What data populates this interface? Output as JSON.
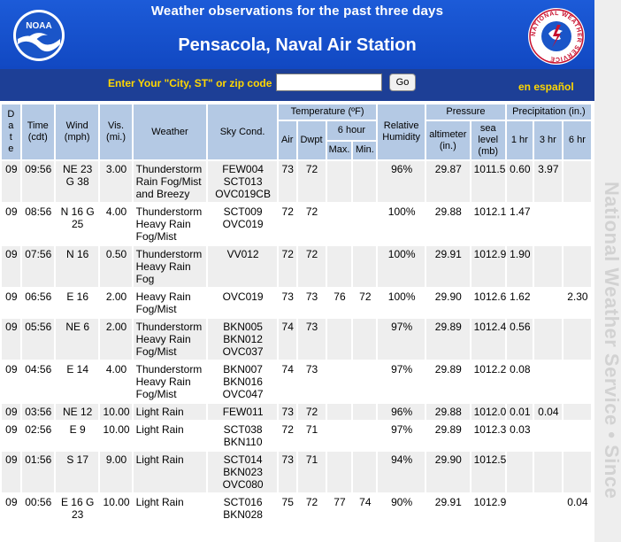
{
  "header": {
    "title": "Weather observations for the past three days",
    "station": "Pensacola, Naval Air Station",
    "noaa_logo_text": "NOAA",
    "nws_logo_text": "NATIONAL WEATHER SERVICE"
  },
  "search": {
    "prompt": "Enter Your \"City, ST\" or zip code",
    "value": "",
    "go_label": "Go",
    "espanol_label": "en español"
  },
  "side_strip": {
    "text": "National Weather Service • Since"
  },
  "colors": {
    "header_blue": "#1148c2",
    "bar_blue": "#1d3f96",
    "yellow": "#ffd700",
    "header_cell": "#b4c9e4",
    "row_alt": "#eeeeee"
  },
  "table": {
    "headers": {
      "date": "D a t e",
      "time": "Time (cdt)",
      "wind": "Wind (mph)",
      "vis": "Vis. (mi.)",
      "weather": "Weather",
      "sky": "Sky Cond.",
      "temperature": "Temperature (ºF)",
      "humidity": "Relative Humidity",
      "pressure": "Pressure",
      "precip": "Precipitation (in.)",
      "air": "Air",
      "dwpt": "Dwpt",
      "six_hour": "6 hour",
      "max": "Max.",
      "min": "Min.",
      "altimeter": "altimeter (in.)",
      "sea_level": "sea level (mb)",
      "p1": "1 hr",
      "p3": "3 hr",
      "p6": "6 hr"
    },
    "rows": [
      {
        "date": "09",
        "time": "09:56",
        "wind": "NE 23 G 38",
        "vis": "3.00",
        "weather": "Thunderstorm Rain Fog/Mist and Breezy",
        "sky": "FEW004 SCT013 OVC019CB",
        "air": "73",
        "dwpt": "72",
        "max": "",
        "min": "",
        "hum": "96%",
        "alt": "29.87",
        "sea": "1011.5",
        "p1": "0.60",
        "p3": "3.97",
        "p6": ""
      },
      {
        "date": "09",
        "time": "08:56",
        "wind": "N 16 G 25",
        "vis": "4.00",
        "weather": "Thunderstorm Heavy Rain Fog/Mist",
        "sky": "SCT009 OVC019",
        "air": "72",
        "dwpt": "72",
        "max": "",
        "min": "",
        "hum": "100%",
        "alt": "29.88",
        "sea": "1012.1",
        "p1": "1.47",
        "p3": "",
        "p6": ""
      },
      {
        "date": "09",
        "time": "07:56",
        "wind": "N 16",
        "vis": "0.50",
        "weather": "Thunderstorm Heavy Rain Fog",
        "sky": "VV012",
        "air": "72",
        "dwpt": "72",
        "max": "",
        "min": "",
        "hum": "100%",
        "alt": "29.91",
        "sea": "1012.9",
        "p1": "1.90",
        "p3": "",
        "p6": ""
      },
      {
        "date": "09",
        "time": "06:56",
        "wind": "E 16",
        "vis": "2.00",
        "weather": "Heavy Rain Fog/Mist",
        "sky": "OVC019",
        "air": "73",
        "dwpt": "73",
        "max": "76",
        "min": "72",
        "hum": "100%",
        "alt": "29.90",
        "sea": "1012.6",
        "p1": "1.62",
        "p3": "",
        "p6": "2.30"
      },
      {
        "date": "09",
        "time": "05:56",
        "wind": "NE 6",
        "vis": "2.00",
        "weather": "Thunderstorm Heavy Rain Fog/Mist",
        "sky": "BKN005 BKN012 OVC037",
        "air": "74",
        "dwpt": "73",
        "max": "",
        "min": "",
        "hum": "97%",
        "alt": "29.89",
        "sea": "1012.4",
        "p1": "0.56",
        "p3": "",
        "p6": ""
      },
      {
        "date": "09",
        "time": "04:56",
        "wind": "E 14",
        "vis": "4.00",
        "weather": "Thunderstorm Heavy Rain Fog/Mist",
        "sky": "BKN007 BKN016 OVC047",
        "air": "74",
        "dwpt": "73",
        "max": "",
        "min": "",
        "hum": "97%",
        "alt": "29.89",
        "sea": "1012.2",
        "p1": "0.08",
        "p3": "",
        "p6": ""
      },
      {
        "date": "09",
        "time": "03:56",
        "wind": "NE 12",
        "vis": "10.00",
        "weather": "Light Rain",
        "sky": "FEW011",
        "air": "73",
        "dwpt": "72",
        "max": "",
        "min": "",
        "hum": "96%",
        "alt": "29.88",
        "sea": "1012.0",
        "p1": "0.01",
        "p3": "0.04",
        "p6": ""
      },
      {
        "date": "09",
        "time": "02:56",
        "wind": "E 9",
        "vis": "10.00",
        "weather": "Light Rain",
        "sky": "SCT038 BKN110",
        "air": "72",
        "dwpt": "71",
        "max": "",
        "min": "",
        "hum": "97%",
        "alt": "29.89",
        "sea": "1012.3",
        "p1": "0.03",
        "p3": "",
        "p6": ""
      },
      {
        "date": "09",
        "time": "01:56",
        "wind": "S 17",
        "vis": "9.00",
        "weather": "Light Rain",
        "sky": "SCT014 BKN023 OVC080",
        "air": "73",
        "dwpt": "71",
        "max": "",
        "min": "",
        "hum": "94%",
        "alt": "29.90",
        "sea": "1012.5",
        "p1": "",
        "p3": "",
        "p6": ""
      },
      {
        "date": "09",
        "time": "00:56",
        "wind": "E 16 G 23",
        "vis": "10.00",
        "weather": "Light Rain",
        "sky": "SCT016 BKN028",
        "air": "75",
        "dwpt": "72",
        "max": "77",
        "min": "74",
        "hum": "90%",
        "alt": "29.91",
        "sea": "1012.9",
        "p1": "",
        "p3": "",
        "p6": "0.04"
      }
    ]
  }
}
